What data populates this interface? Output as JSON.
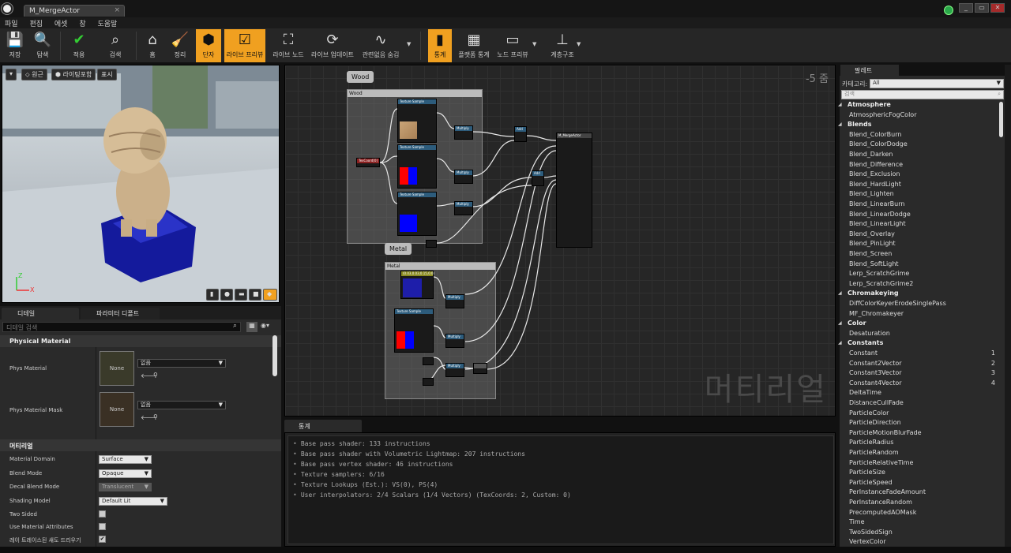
{
  "window": {
    "doc_tab": "M_MergeActor",
    "doc_tab_close": "×",
    "minimize": "_",
    "restore": "▭",
    "close": "✕"
  },
  "menu": [
    "파일",
    "편집",
    "에셋",
    "창",
    "도움말"
  ],
  "toolbar": {
    "save": "저장",
    "browse": "탐색",
    "apply": "적용",
    "search": "검색",
    "home": "홈",
    "clean_up": "정리",
    "connectors": "단자",
    "live_preview": "라이브 프리뷰",
    "live_nodes": "라이브 노드",
    "live_update": "라이브 업데이트",
    "hide_unrelated": "관련없음 숨김",
    "stats": "통계",
    "platform_stats": "플랫폼 통계",
    "node_preview": "노드 프리뷰",
    "hierarchy": "계층구조"
  },
  "viewport": {
    "btn_menu": "▾",
    "btn_perspective": "원근",
    "btn_lit": "라이팅포함",
    "btn_show": "표시",
    "axis_x": "X",
    "axis_z": "Z"
  },
  "details": {
    "tab_details": "디테일",
    "tab_params": "파라미터 디폴트",
    "search_placeholder": "디테일 검색",
    "cat_physical": "Physical Material",
    "phys_material": "Phys Material",
    "phys_material_mask": "Phys Material Mask",
    "none": "None",
    "none_value": "없음",
    "cat_material": "머티리얼",
    "rows": [
      {
        "label": "Material Domain",
        "value": "Surface"
      },
      {
        "label": "Blend Mode",
        "value": "Opaque"
      },
      {
        "label": "Decal Blend Mode",
        "value": "Translucent"
      },
      {
        "label": "Shading Model",
        "value": "Default Lit"
      },
      {
        "label": "Two Sided",
        "value": ""
      },
      {
        "label": "Use Material Attributes",
        "value": ""
      },
      {
        "label": "레이 트레이스된 섀도 드리우기",
        "value": "✔"
      }
    ]
  },
  "graph": {
    "zoom": "-5 줌",
    "watermark": "머티리얼",
    "comment_wood": "Wood",
    "comment_metal": "Metal",
    "texture_sample": "Texture Sample",
    "multiply": "Multiply",
    "add": "Add",
    "texcoord": "TexCoord[0]",
    "result_node": "M_MergeActor",
    "metal_param": "(0.03,0.03,0.15,0.0)"
  },
  "stats": {
    "tab": "통계",
    "lines": [
      "Base pass shader: 133 instructions",
      "Base pass shader with Volumetric Lightmap: 207 instructions",
      "Base pass vertex shader: 46 instructions",
      "Texture samplers: 6/16",
      "Texture Lookups (Est.): VS(0), PS(4)",
      "User interpolators: 2/4 Scalars (1/4 Vectors) (TexCoords: 2, Custom: 0)"
    ]
  },
  "palette": {
    "tab": "팔레트",
    "category_label": "카테고리:",
    "category_value": "All",
    "search_placeholder": "검색",
    "entries": [
      {
        "kind": "cat",
        "text": "Atmosphere"
      },
      {
        "kind": "item",
        "text": "AtmosphericFogColor"
      },
      {
        "kind": "cat",
        "text": "Blends"
      },
      {
        "kind": "item",
        "text": "Blend_ColorBurn"
      },
      {
        "kind": "item",
        "text": "Blend_ColorDodge"
      },
      {
        "kind": "item",
        "text": "Blend_Darken"
      },
      {
        "kind": "item",
        "text": "Blend_Difference"
      },
      {
        "kind": "item",
        "text": "Blend_Exclusion"
      },
      {
        "kind": "item",
        "text": "Blend_HardLight"
      },
      {
        "kind": "item",
        "text": "Blend_Lighten"
      },
      {
        "kind": "item",
        "text": "Blend_LinearBurn"
      },
      {
        "kind": "item",
        "text": "Blend_LinearDodge"
      },
      {
        "kind": "item",
        "text": "Blend_LinearLight"
      },
      {
        "kind": "item",
        "text": "Blend_Overlay"
      },
      {
        "kind": "item",
        "text": "Blend_PinLight"
      },
      {
        "kind": "item",
        "text": "Blend_Screen"
      },
      {
        "kind": "item",
        "text": "Blend_SoftLight"
      },
      {
        "kind": "item",
        "text": "Lerp_ScratchGrime"
      },
      {
        "kind": "item",
        "text": "Lerp_ScratchGrime2"
      },
      {
        "kind": "cat",
        "text": "Chromakeying"
      },
      {
        "kind": "item",
        "text": "DiffColorKeyerErodeSinglePass"
      },
      {
        "kind": "item",
        "text": "MF_Chromakeyer"
      },
      {
        "kind": "cat",
        "text": "Color"
      },
      {
        "kind": "item",
        "text": "Desaturation"
      },
      {
        "kind": "cat",
        "text": "Constants"
      },
      {
        "kind": "item",
        "text": "Constant",
        "key": "1"
      },
      {
        "kind": "item",
        "text": "Constant2Vector",
        "key": "2"
      },
      {
        "kind": "item",
        "text": "Constant3Vector",
        "key": "3"
      },
      {
        "kind": "item",
        "text": "Constant4Vector",
        "key": "4"
      },
      {
        "kind": "item",
        "text": "DeltaTime"
      },
      {
        "kind": "item",
        "text": "DistanceCullFade"
      },
      {
        "kind": "item",
        "text": "ParticleColor"
      },
      {
        "kind": "item",
        "text": "ParticleDirection"
      },
      {
        "kind": "item",
        "text": "ParticleMotionBlurFade"
      },
      {
        "kind": "item",
        "text": "ParticleRadius"
      },
      {
        "kind": "item",
        "text": "ParticleRandom"
      },
      {
        "kind": "item",
        "text": "ParticleRelativeTime"
      },
      {
        "kind": "item",
        "text": "ParticleSize"
      },
      {
        "kind": "item",
        "text": "ParticleSpeed"
      },
      {
        "kind": "item",
        "text": "PerInstanceFadeAmount"
      },
      {
        "kind": "item",
        "text": "PerInstanceRandom"
      },
      {
        "kind": "item",
        "text": "PrecomputedAOMask"
      },
      {
        "kind": "item",
        "text": "Time"
      },
      {
        "kind": "item",
        "text": "TwoSidedSign"
      },
      {
        "kind": "item",
        "text": "VertexColor"
      }
    ]
  }
}
